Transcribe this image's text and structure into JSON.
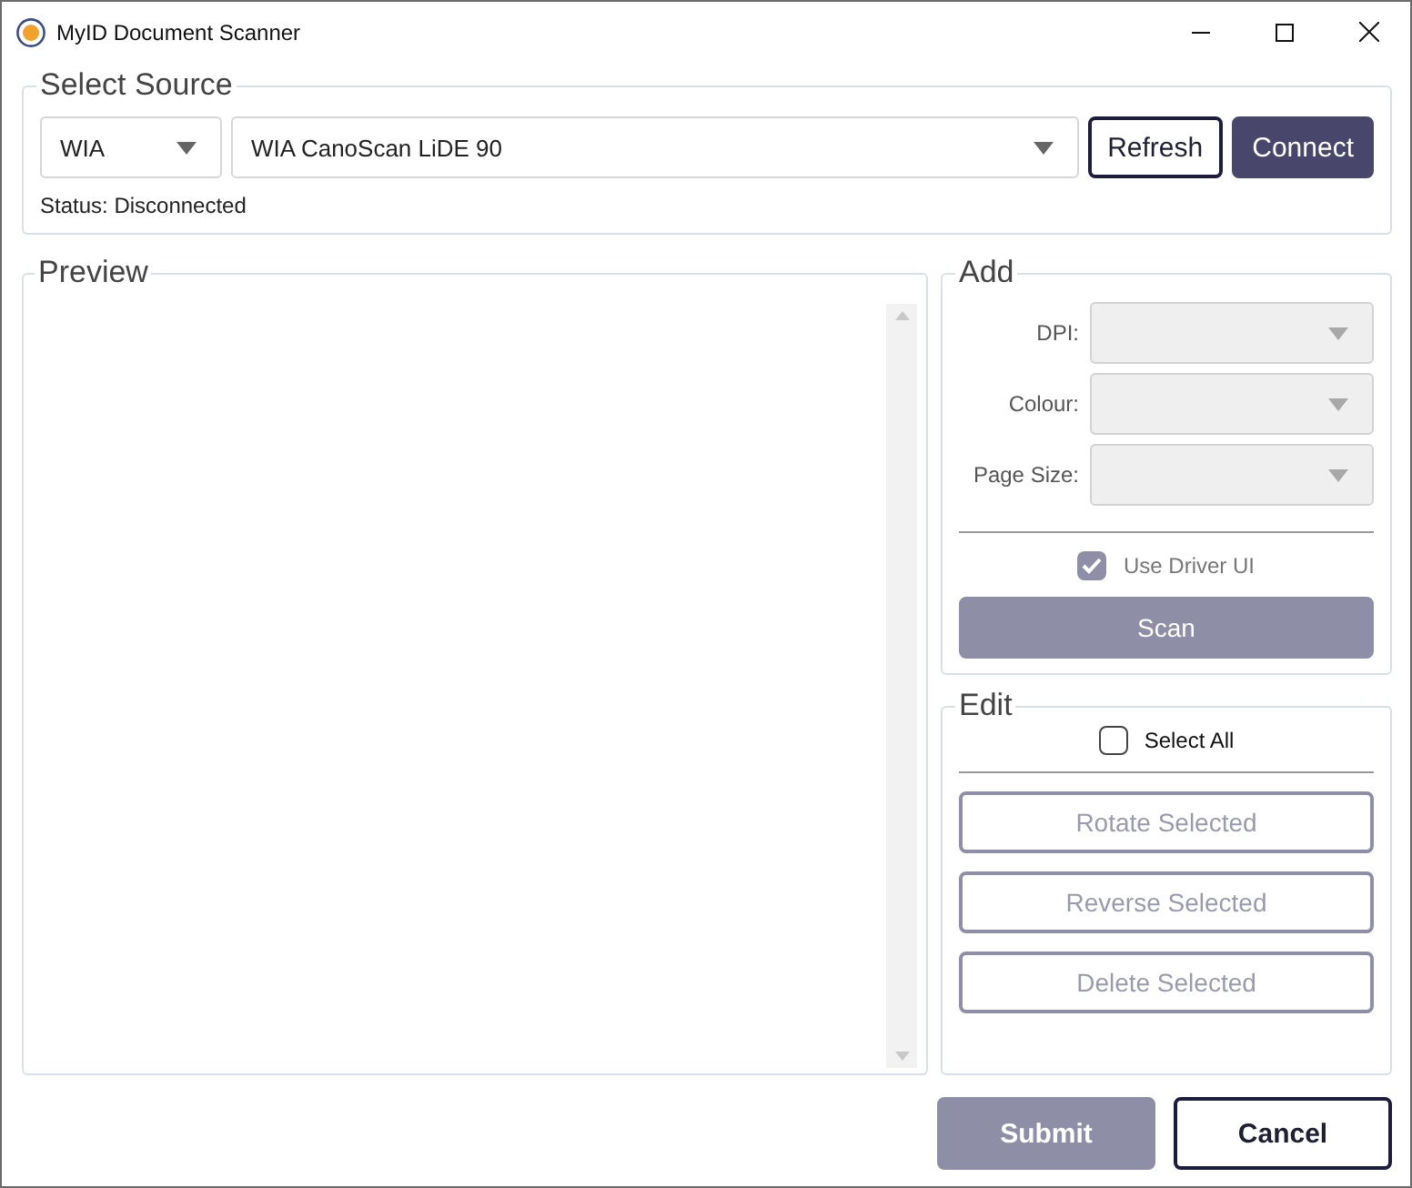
{
  "window": {
    "title": "MyID Document Scanner"
  },
  "source": {
    "title": "Select Source",
    "driver": {
      "value": "WIA"
    },
    "device": {
      "value": "WIA CanoScan LiDE 90"
    },
    "buttons": [
      {
        "label": "Refresh",
        "kind": "outline"
      },
      {
        "label": "Connect",
        "kind": "primary"
      }
    ],
    "status": "Status: Disconnected"
  },
  "preview": {
    "title": "Preview"
  },
  "add": {
    "title": "Add",
    "fields": [
      {
        "label": "DPI:",
        "disabled": true
      },
      {
        "label": "Colour:",
        "disabled": true
      },
      {
        "label": "Page Size:",
        "disabled": true
      }
    ],
    "use_driver_ui": {
      "label": "Use Driver UI",
      "checked": true,
      "disabled": true
    },
    "scan": {
      "label": "Scan",
      "disabled": true
    }
  },
  "edit": {
    "title": "Edit",
    "select_all": {
      "label": "Select All",
      "checked": false,
      "disabled": false
    },
    "buttons": [
      {
        "label": "Rotate Selected",
        "disabled": true
      },
      {
        "label": "Reverse Selected",
        "disabled": true
      },
      {
        "label": "Delete Selected",
        "disabled": true
      }
    ]
  },
  "footer": [
    {
      "label": "Submit",
      "kind": "primary",
      "disabled": true
    },
    {
      "label": "Cancel",
      "kind": "outline",
      "disabled": false
    }
  ]
}
